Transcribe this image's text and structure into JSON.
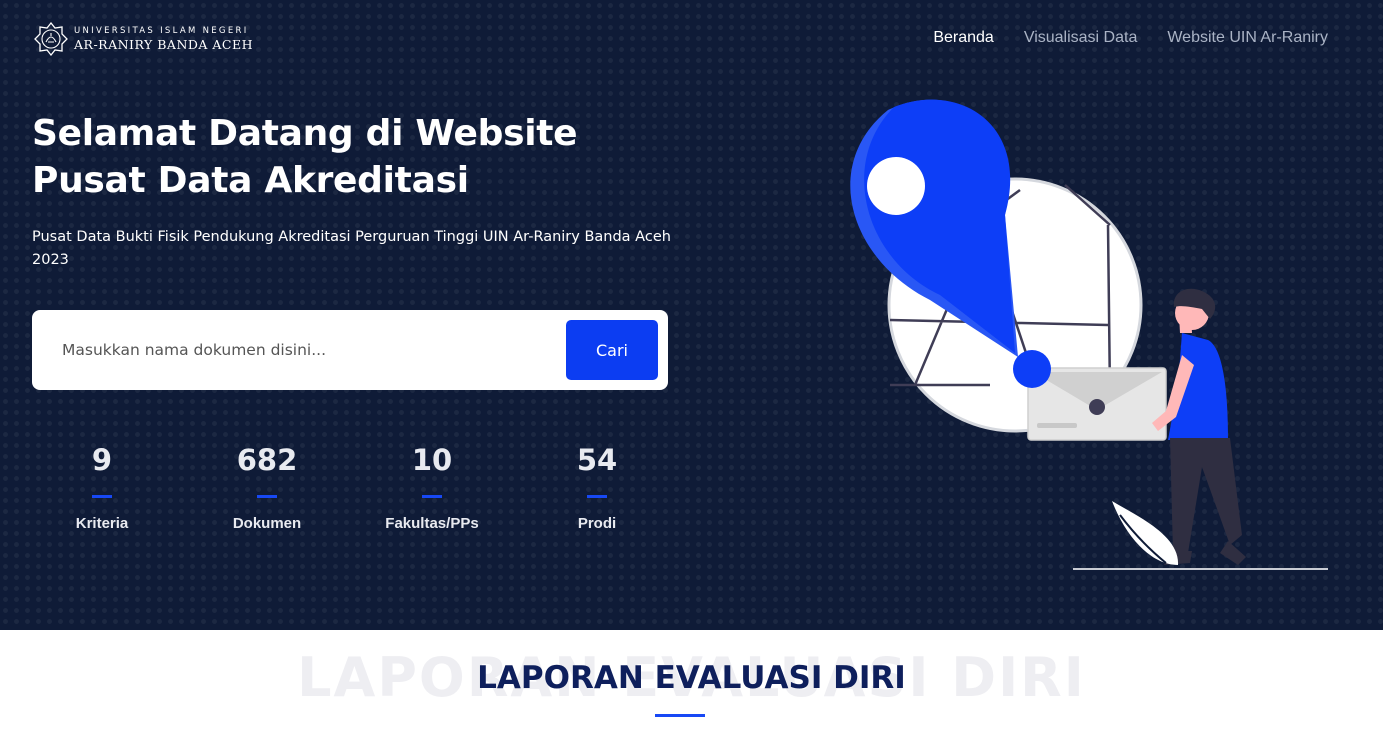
{
  "logo": {
    "line1": "UNIVERSITAS ISLAM NEGERI",
    "line2": "AR-RANIRY BANDA ACEH"
  },
  "nav": {
    "items": [
      {
        "label": "Beranda",
        "active": true
      },
      {
        "label": "Visualisasi Data",
        "active": false
      },
      {
        "label": "Website UIN Ar-Raniry",
        "active": false
      }
    ]
  },
  "hero": {
    "title_line1": "Selamat Datang di Website",
    "title_line2": "Pusat Data Akreditasi",
    "subtitle_line1": "Pusat Data Bukti Fisik Pendukung Akreditasi Perguruan Tinggi UIN Ar-Raniry Banda Aceh",
    "subtitle_line2": "2023"
  },
  "search": {
    "placeholder": "Masukkan nama dokumen disini...",
    "value": "",
    "button_label": "Cari"
  },
  "stats": [
    {
      "value": "9",
      "label": "Kriteria"
    },
    {
      "value": "682",
      "label": "Dokumen"
    },
    {
      "value": "10",
      "label": "Fakultas/PPs"
    },
    {
      "value": "54",
      "label": "Prodi"
    }
  ],
  "section": {
    "title": "LAPORAN EVALUASI DIRI",
    "background_text": "LAPORAN EVALUASI DIRI"
  },
  "colors": {
    "hero_bg": "#0f1b37",
    "accent": "#0c3df2",
    "section_title": "#0e1f5c"
  }
}
